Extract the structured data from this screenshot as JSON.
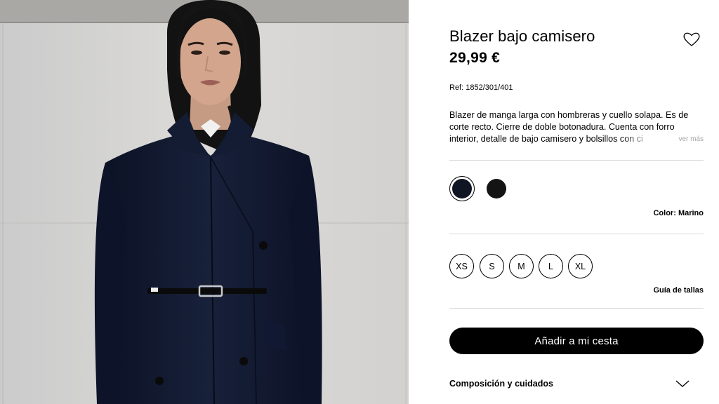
{
  "product": {
    "title": "Blazer bajo camisero",
    "price": "29,99 €",
    "ref_label": "Ref: ",
    "ref_value": "1852/301/401",
    "description": "Blazer de manga larga con hombreras y cuello solapa. Es de corte recto. Cierre de doble botonadura. Cuenta con forro interior, detalle de bajo camisero y bolsillos con ci",
    "more_label": "ver más",
    "favorite_icon": "heart-icon"
  },
  "colors": {
    "label": "Color: ",
    "selected": "Marino",
    "swatches": [
      {
        "name": "Marino",
        "hex": "#0f1522"
      },
      {
        "name": "Negro",
        "hex": "#141414"
      }
    ]
  },
  "sizes": {
    "options": [
      "XS",
      "S",
      "M",
      "L",
      "XL"
    ],
    "guide_label": "Guía de tallas"
  },
  "cart": {
    "add_label": "Añadir a mi cesta"
  },
  "composition": {
    "label": "Composición y cuidados",
    "icon": "chevron-down-icon"
  }
}
